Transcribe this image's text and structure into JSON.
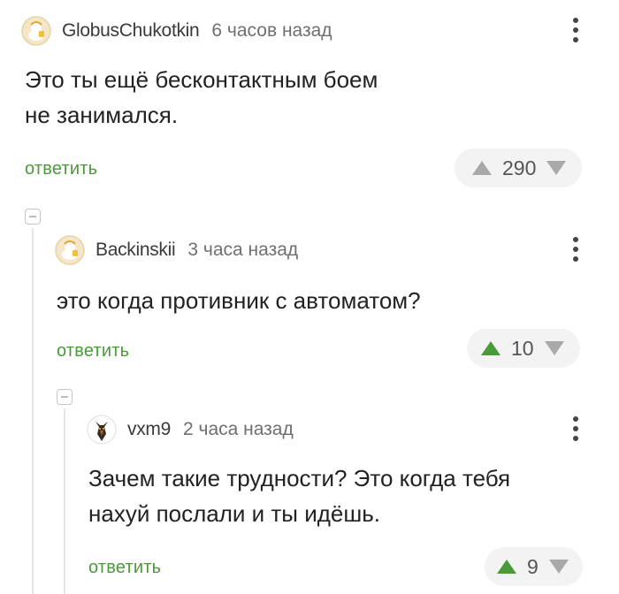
{
  "comments": [
    {
      "username": "GlobusChukotkin",
      "time": "6 часов назад",
      "lines": [
        "Это ты ещё бесконтактным боем",
        "не занимался."
      ],
      "reply_label": "ответить",
      "rating": "290",
      "upvote_color": "#a9a9a9"
    },
    {
      "username": "Backinskii",
      "time": "3 часа назад",
      "lines": [
        "это когда противник с автоматом?"
      ],
      "reply_label": "ответить",
      "rating": "10",
      "upvote_color": "#4a9a3a"
    },
    {
      "username": "vxm9",
      "time": "2 часа назад",
      "lines": [
        "Зачем такие трудности? Это когда тебя",
        "нахуй послали и ты идёшь."
      ],
      "reply_label": "ответить",
      "rating": "9",
      "upvote_color": "#4a9a3a"
    }
  ],
  "icons": {
    "menu": "more-vertical-icon",
    "upvote": "triangle-up-icon",
    "downvote": "triangle-down-icon",
    "collapse": "minus-square-icon",
    "avatar_default": "default-avatar-icon"
  },
  "colors": {
    "accent_green": "#4a9a3a",
    "downvote_gray": "#a9a9a9",
    "rating_bg": "#f3f3f3"
  }
}
